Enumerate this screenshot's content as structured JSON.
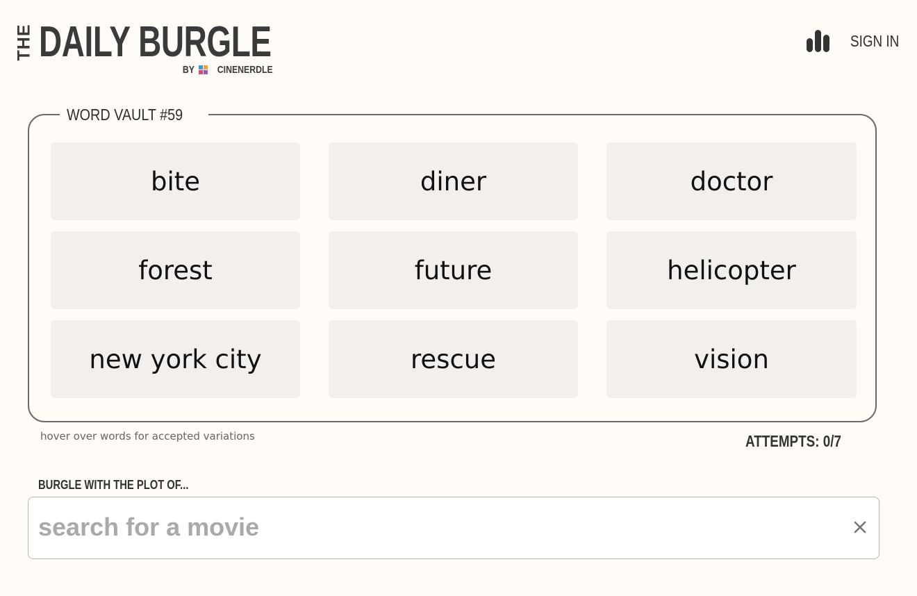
{
  "header": {
    "logo_the": "THE",
    "logo_title": "DAILY BURGLE",
    "logo_by": "BY",
    "logo_brand": "CINENERDLE",
    "brand_colors": [
      "#3b9ad9",
      "#f0a03c",
      "#d94a7a",
      "#9b59b6"
    ],
    "stats_icon": "bar-chart-icon",
    "signin_label": "SIGN IN"
  },
  "vault": {
    "title": "WORD VAULT #59",
    "words": [
      "bite",
      "diner",
      "doctor",
      "forest",
      "future",
      "helicopter",
      "new york city",
      "rescue",
      "vision"
    ],
    "hint": "hover over words for accepted variations",
    "attempts_label": "ATTEMPTS: 0/7",
    "attempts_used": 0,
    "attempts_max": 7
  },
  "search": {
    "label": "BURGLE WITH THE PLOT OF...",
    "placeholder": "search for a movie",
    "value": "",
    "clear_icon": "close-icon"
  },
  "colors": {
    "background": "#fffbf7",
    "tile": "#f2efec",
    "text_dark": "#3a3a3a"
  }
}
